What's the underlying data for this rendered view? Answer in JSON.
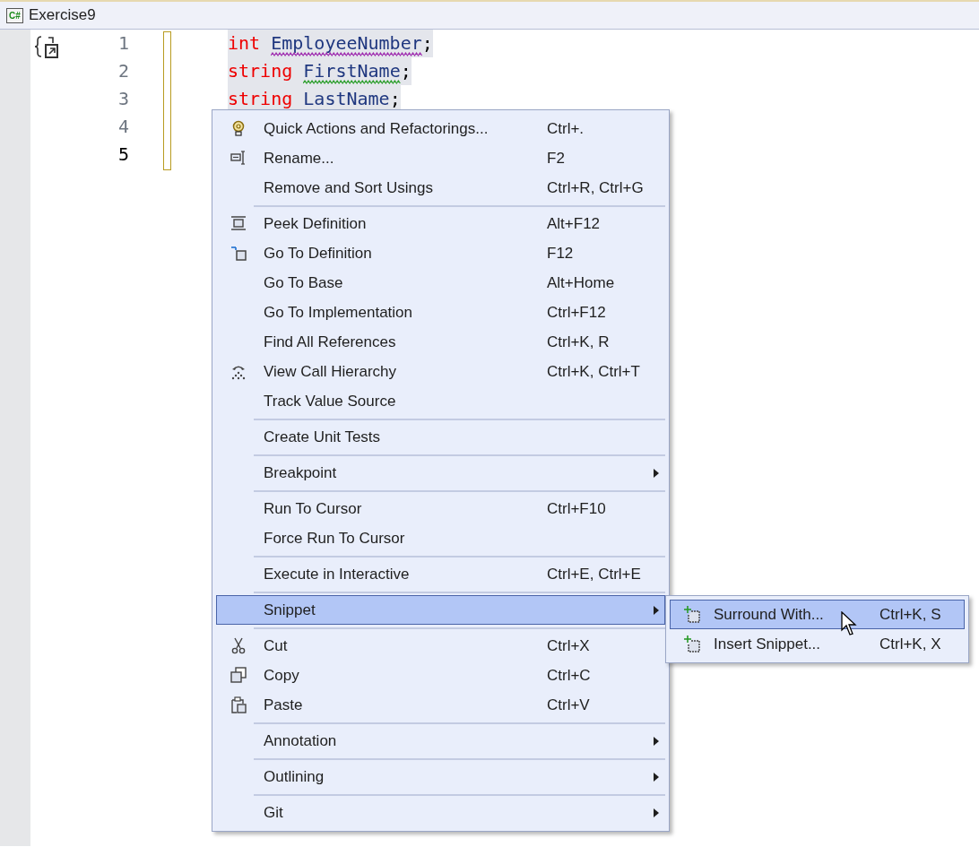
{
  "document_tab": {
    "badge": "C#",
    "title": "Exercise9"
  },
  "editor": {
    "lines": [
      {
        "number": "1",
        "current": false,
        "tokens": [
          {
            "kind": "keyword",
            "text": "int"
          },
          {
            "kind": "identifier",
            "text": "EmployeeNumber",
            "squiggle": {
              "color": "#a030b0"
            }
          },
          {
            "kind": "punct",
            "text": ";"
          }
        ]
      },
      {
        "number": "2",
        "current": false,
        "tokens": [
          {
            "kind": "keyword",
            "text": "string"
          },
          {
            "kind": "identifier",
            "text": "FirstName",
            "squiggle": {
              "color": "#30a030"
            }
          },
          {
            "kind": "punct",
            "text": ";"
          }
        ]
      },
      {
        "number": "3",
        "current": false,
        "tokens": [
          {
            "kind": "keyword",
            "text": "string"
          },
          {
            "kind": "identifier",
            "text": "LastName"
          },
          {
            "kind": "punct",
            "text": ";"
          }
        ]
      },
      {
        "number": "4",
        "current": false
      },
      {
        "number": "5",
        "current": true
      }
    ]
  },
  "context_menu": {
    "items": [
      {
        "kind": "item",
        "label": "Quick Actions and Refactorings...",
        "shortcut": "Ctrl+.",
        "has_submenu": false,
        "selected": false
      },
      {
        "kind": "item",
        "label": "Rename...",
        "shortcut": "F2",
        "has_submenu": false,
        "selected": false
      },
      {
        "kind": "item",
        "label": "Remove and Sort Usings",
        "shortcut": "Ctrl+R, Ctrl+G",
        "has_submenu": false,
        "selected": false
      },
      {
        "kind": "separator"
      },
      {
        "kind": "item",
        "label": "Peek Definition",
        "shortcut": "Alt+F12",
        "has_submenu": false,
        "selected": false
      },
      {
        "kind": "item",
        "label": "Go To Definition",
        "shortcut": "F12",
        "has_submenu": false,
        "selected": false
      },
      {
        "kind": "item",
        "label": "Go To Base",
        "shortcut": "Alt+Home",
        "has_submenu": false,
        "selected": false
      },
      {
        "kind": "item",
        "label": "Go To Implementation",
        "shortcut": "Ctrl+F12",
        "has_submenu": false,
        "selected": false
      },
      {
        "kind": "item",
        "label": "Find All References",
        "shortcut": "Ctrl+K, R",
        "has_submenu": false,
        "selected": false
      },
      {
        "kind": "item",
        "label": "View Call Hierarchy",
        "shortcut": "Ctrl+K, Ctrl+T",
        "has_submenu": false,
        "selected": false
      },
      {
        "kind": "item",
        "label": "Track Value Source",
        "has_submenu": false,
        "selected": false
      },
      {
        "kind": "separator"
      },
      {
        "kind": "item",
        "label": "Create Unit Tests",
        "has_submenu": false,
        "selected": false
      },
      {
        "kind": "separator"
      },
      {
        "kind": "item",
        "label": "Breakpoint",
        "has_submenu": true,
        "selected": false
      },
      {
        "kind": "separator"
      },
      {
        "kind": "item",
        "label": "Run To Cursor",
        "shortcut": "Ctrl+F10",
        "has_submenu": false,
        "selected": false
      },
      {
        "kind": "item",
        "label": "Force Run To Cursor",
        "has_submenu": false,
        "selected": false
      },
      {
        "kind": "separator"
      },
      {
        "kind": "item",
        "label": "Execute in Interactive",
        "shortcut": "Ctrl+E, Ctrl+E",
        "has_submenu": false,
        "selected": false
      },
      {
        "kind": "separator"
      },
      {
        "kind": "item",
        "label": "Snippet",
        "has_submenu": true,
        "selected": true
      },
      {
        "kind": "separator"
      },
      {
        "kind": "item",
        "label": "Cut",
        "shortcut": "Ctrl+X",
        "has_submenu": false,
        "selected": false
      },
      {
        "kind": "item",
        "label": "Copy",
        "shortcut": "Ctrl+C",
        "has_submenu": false,
        "selected": false
      },
      {
        "kind": "item",
        "label": "Paste",
        "shortcut": "Ctrl+V",
        "has_submenu": false,
        "selected": false
      },
      {
        "kind": "separator"
      },
      {
        "kind": "item",
        "label": "Annotation",
        "has_submenu": true,
        "selected": false
      },
      {
        "kind": "separator"
      },
      {
        "kind": "item",
        "label": "Outlining",
        "has_submenu": true,
        "selected": false
      },
      {
        "kind": "separator"
      },
      {
        "kind": "item",
        "label": "Git",
        "has_submenu": true,
        "selected": false
      }
    ]
  },
  "snippet_submenu": {
    "items": [
      {
        "kind": "item",
        "label": "Surround With...",
        "shortcut": "Ctrl+K, S",
        "has_submenu": false,
        "selected": true
      },
      {
        "kind": "item",
        "label": "Insert Snippet...",
        "shortcut": "Ctrl+K, X",
        "has_submenu": false,
        "selected": false
      }
    ]
  }
}
